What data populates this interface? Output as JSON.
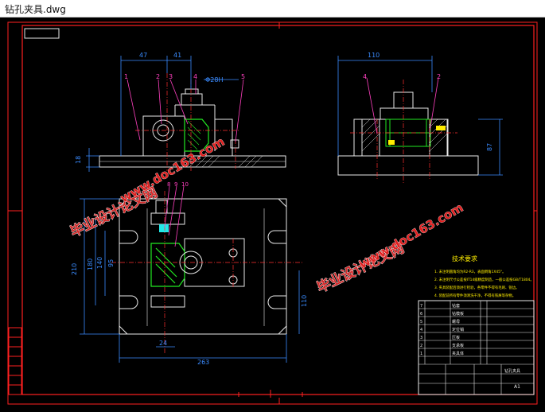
{
  "window": {
    "title": "钻孔夹具.dwg"
  },
  "drawing": {
    "colors": {
      "frame": "#ff2020",
      "outline": "#e8e8e8",
      "dimension": "#3a8bff",
      "leader": "#ff40c0",
      "part": "#22e822",
      "center": "#ff3030",
      "label": "#ffee00"
    },
    "front_view": {
      "dims": {
        "d1": "47",
        "d2": "41",
        "hole": "Φ28H",
        "height": "18"
      },
      "balloons": [
        "1",
        "2",
        "3",
        "4",
        "5"
      ]
    },
    "side_view": {
      "dims": {
        "width": "110",
        "height": "87"
      },
      "balloons": [
        "4",
        "2"
      ]
    },
    "top_view": {
      "dims": {
        "overall_height": "210",
        "h2": "180",
        "h3": "140",
        "h4": "95",
        "right": "110",
        "small": "24",
        "overall_width": "263"
      },
      "balloons": [
        "8",
        "9",
        "10"
      ]
    },
    "notes": {
      "title": "技术要求",
      "lines": [
        "1. 未注明圆角均为R2-R3，表面倒角1X45°。",
        "2. 未注明尺寸公差按IT14级精度制造，一般公差按GB/T1804。",
        "3. 夹具装配后须进行检验，各零件不得有毛刺、锐边。",
        "4. 装配前所有零件须清洗干净，不得有铁屑等杂物。"
      ]
    },
    "title_block": {
      "drawing_name": "钻孔夹具",
      "sheet_size": "A1",
      "rows": [
        {
          "no": "7",
          "name": "钻套"
        },
        {
          "no": "6",
          "name": "钻模板"
        },
        {
          "no": "5",
          "name": "螺母"
        },
        {
          "no": "4",
          "name": "定位销"
        },
        {
          "no": "3",
          "name": "压板"
        },
        {
          "no": "2",
          "name": "支承板"
        },
        {
          "no": "1",
          "name": "夹具体"
        }
      ]
    },
    "watermarks": [
      {
        "text": "毕业设计论文网"
      },
      {
        "text": "www.doc163.com"
      }
    ]
  }
}
